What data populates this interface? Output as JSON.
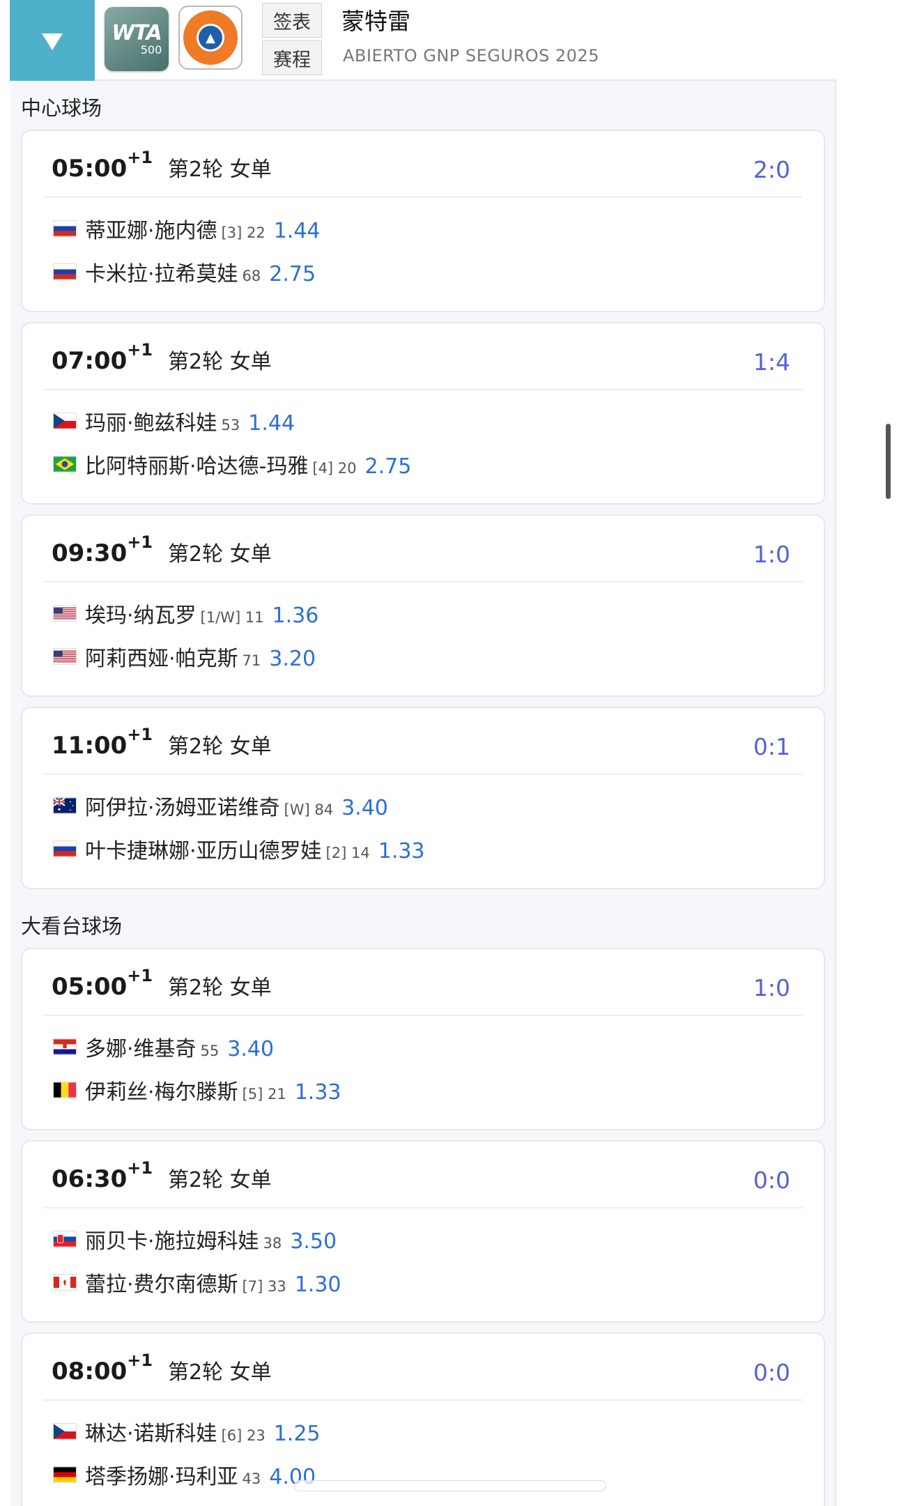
{
  "header": {
    "wta_logo_text": "WTA",
    "wta_logo_tier": "500",
    "event_logo_text": "ABIERTO GNP SEGUROS",
    "tabs": [
      "签表",
      "赛程"
    ],
    "title": "蒙特雷",
    "subtitle": "ABIERTO GNP SEGUROS 2025"
  },
  "colors": {
    "accent": "#4fb0cc",
    "odds": "#2b6fd6",
    "score": "#5561d6"
  },
  "sections": [
    {
      "label": "中心球场",
      "matches": [
        {
          "time": "05:00",
          "day_offset": "+1",
          "round": "第2轮 女单",
          "score": "2:0",
          "players": [
            {
              "flag": "RU",
              "name": "蒂亚娜·施内德",
              "meta": "[3] 22",
              "odds": "1.44"
            },
            {
              "flag": "RU",
              "name": "卡米拉·拉希莫娃",
              "meta": "68",
              "odds": "2.75"
            }
          ]
        },
        {
          "time": "07:00",
          "day_offset": "+1",
          "round": "第2轮 女单",
          "score": "1:4",
          "players": [
            {
              "flag": "CZ",
              "name": "玛丽·鲍兹科娃",
              "meta": "53",
              "odds": "1.44"
            },
            {
              "flag": "BR",
              "name": "比阿特丽斯·哈达德-玛雅",
              "meta": "[4] 20",
              "odds": "2.75"
            }
          ]
        },
        {
          "time": "09:30",
          "day_offset": "+1",
          "round": "第2轮 女单",
          "score": "1:0",
          "players": [
            {
              "flag": "US",
              "name": "埃玛·纳瓦罗",
              "meta": "[1/W] 11",
              "odds": "1.36"
            },
            {
              "flag": "US",
              "name": "阿莉西娅·帕克斯",
              "meta": "71",
              "odds": "3.20"
            }
          ]
        },
        {
          "time": "11:00",
          "day_offset": "+1",
          "round": "第2轮 女单",
          "score": "0:1",
          "players": [
            {
              "flag": "AU",
              "name": "阿伊拉·汤姆亚诺维奇",
              "meta": "[W] 84",
              "odds": "3.40"
            },
            {
              "flag": "RU",
              "name": "叶卡捷琳娜·亚历山德罗娃",
              "meta": "[2] 14",
              "odds": "1.33"
            }
          ]
        }
      ]
    },
    {
      "label": "大看台球场",
      "matches": [
        {
          "time": "05:00",
          "day_offset": "+1",
          "round": "第2轮 女单",
          "score": "1:0",
          "players": [
            {
              "flag": "HR",
              "name": "多娜·维基奇",
              "meta": "55",
              "odds": "3.40"
            },
            {
              "flag": "BE",
              "name": "伊莉丝·梅尔滕斯",
              "meta": "[5] 21",
              "odds": "1.33"
            }
          ]
        },
        {
          "time": "06:30",
          "day_offset": "+1",
          "round": "第2轮 女单",
          "score": "0:0",
          "players": [
            {
              "flag": "SK",
              "name": "丽贝卡·施拉姆科娃",
              "meta": "38",
              "odds": "3.50"
            },
            {
              "flag": "CA",
              "name": "蕾拉·费尔南德斯",
              "meta": "[7] 33",
              "odds": "1.30"
            }
          ]
        },
        {
          "time": "08:00",
          "day_offset": "+1",
          "round": "第2轮 女单",
          "score": "0:0",
          "players": [
            {
              "flag": "CZ",
              "name": "琳达·诺斯科娃",
              "meta": "[6] 23",
              "odds": "1.25"
            },
            {
              "flag": "DE",
              "name": "塔季扬娜·玛利亚",
              "meta": "43",
              "odds": "4.00"
            }
          ]
        }
      ]
    }
  ]
}
